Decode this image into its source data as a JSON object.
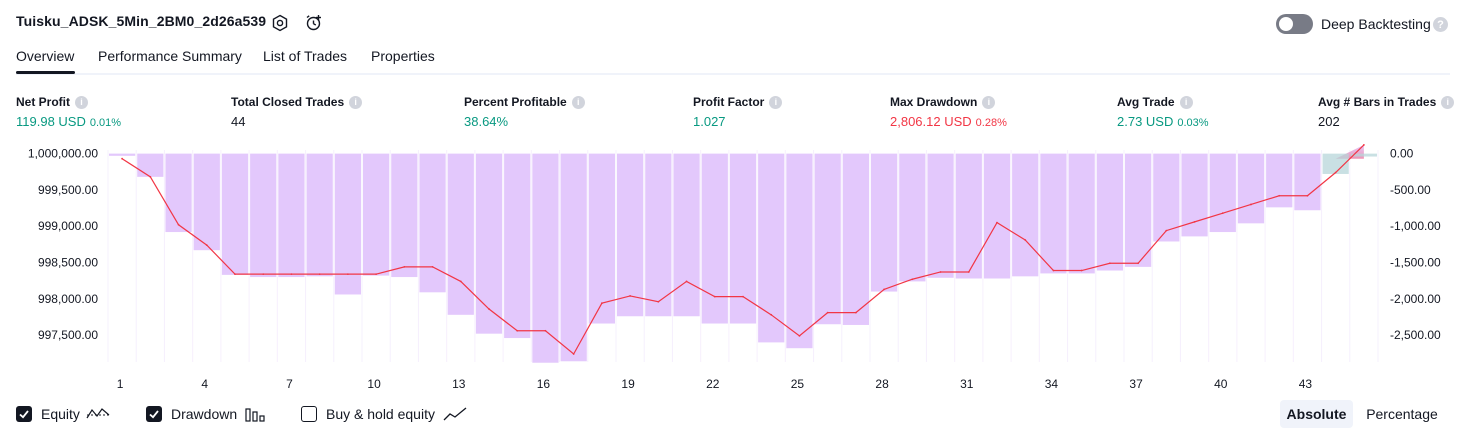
{
  "header": {
    "title": "Tuisku_ADSK_5Min_2BM0_2d26a539",
    "settings_icon": "gear-icon",
    "alert_icon": "alarm-clock-add-icon",
    "deep_backtesting_label": "Deep Backtesting",
    "deep_backtesting_enabled": false,
    "help_glyph": "?"
  },
  "tabs": [
    "Overview",
    "Performance Summary",
    "List of Trades",
    "Properties"
  ],
  "active_tab": "Overview",
  "stats": [
    {
      "label": "Net Profit",
      "value": "119.98 USD",
      "pct": "0.01%",
      "tone": "green"
    },
    {
      "label": "Total Closed Trades",
      "value": "44",
      "pct": "",
      "tone": "dark"
    },
    {
      "label": "Percent Profitable",
      "value": "38.64%",
      "pct": "",
      "tone": "green"
    },
    {
      "label": "Profit Factor",
      "value": "1.027",
      "pct": "",
      "tone": "green"
    },
    {
      "label": "Max Drawdown",
      "value": "2,806.12 USD",
      "pct": "0.28%",
      "tone": "red"
    },
    {
      "label": "Avg Trade",
      "value": "2.73 USD",
      "pct": "0.03%",
      "tone": "green"
    },
    {
      "label": "Avg # Bars in Trades",
      "value": "202",
      "pct": "",
      "tone": "dark"
    }
  ],
  "info_glyph": "i",
  "chart_data": {
    "type": "line",
    "x": [
      1,
      2,
      3,
      4,
      5,
      6,
      7,
      8,
      9,
      10,
      11,
      12,
      13,
      14,
      15,
      16,
      17,
      18,
      19,
      20,
      21,
      22,
      23,
      24,
      25,
      26,
      27,
      28,
      29,
      30,
      31,
      32,
      33,
      34,
      35,
      36,
      37,
      38,
      39,
      40,
      41,
      42,
      43,
      44,
      45
    ],
    "x_ticks": [
      "1",
      "4",
      "7",
      "10",
      "13",
      "16",
      "19",
      "22",
      "25",
      "28",
      "31",
      "34",
      "37",
      "40",
      "43"
    ],
    "y_left_ticks": [
      "1,000,000.00",
      "999,500.00",
      "999,000.00",
      "998,500.00",
      "998,000.00",
      "997,500.00"
    ],
    "y_left_values": [
      1000000,
      999500,
      999000,
      998500,
      998000,
      997500
    ],
    "y_right_ticks": [
      "0.00",
      "-500.00",
      "-1,000.00",
      "-1,500.00",
      "-2,000.00",
      "-2,500.00"
    ],
    "y_right_values": [
      0,
      -500,
      -1000,
      -1500,
      -2000,
      -2500
    ],
    "ylim_left": [
      997130,
      1000050
    ],
    "ylim_right": [
      -2870,
      50
    ],
    "series": [
      {
        "name": "Equity",
        "color": "#f23645",
        "values": [
          999930,
          999680,
          999020,
          998740,
          998340,
          998340,
          998340,
          998340,
          998340,
          998340,
          998440,
          998440,
          998240,
          997860,
          997560,
          997560,
          997240,
          997940,
          998040,
          997960,
          998240,
          998030,
          998030,
          997780,
          997490,
          997810,
          997810,
          998130,
          998270,
          998370,
          998370,
          999050,
          998810,
          998390,
          998390,
          998490,
          998490,
          998940,
          999060,
          999180,
          999300,
          999420,
          999420,
          999740,
          1000120
        ]
      },
      {
        "name": "Drawdown",
        "color": "#c9a0f7",
        "values": [
          -30,
          -320,
          -1080,
          -1330,
          -1670,
          -1700,
          -1700,
          -1690,
          -1940,
          -1680,
          -1700,
          -1910,
          -2220,
          -2480,
          -2540,
          -2880,
          -2860,
          -2340,
          -2240,
          -2240,
          -2240,
          -2340,
          -2340,
          -2600,
          -2680,
          -2350,
          -2360,
          -1900,
          -1760,
          -1710,
          -1720,
          -1720,
          -1690,
          -1650,
          -1650,
          -1610,
          -1560,
          -1210,
          -1140,
          -1080,
          -960,
          -740,
          -780,
          -280,
          -40
        ]
      }
    ],
    "benchmark": {
      "name": "Buy & hold equity",
      "enabled": false
    }
  },
  "legend": [
    {
      "label": "Equity",
      "checked": true,
      "icon": "equity-line-icon"
    },
    {
      "label": "Drawdown",
      "checked": true,
      "icon": "drawdown-bars-icon"
    },
    {
      "label": "Buy & hold equity",
      "checked": false,
      "icon": "buy-hold-line-icon"
    }
  ],
  "view_modes": [
    "Absolute",
    "Percentage"
  ],
  "active_view_mode": "Absolute",
  "colors": {
    "accent_green": "#089981",
    "accent_red": "#f23645",
    "drawdown_purple": "#c9a0f7",
    "text": "#131722"
  }
}
